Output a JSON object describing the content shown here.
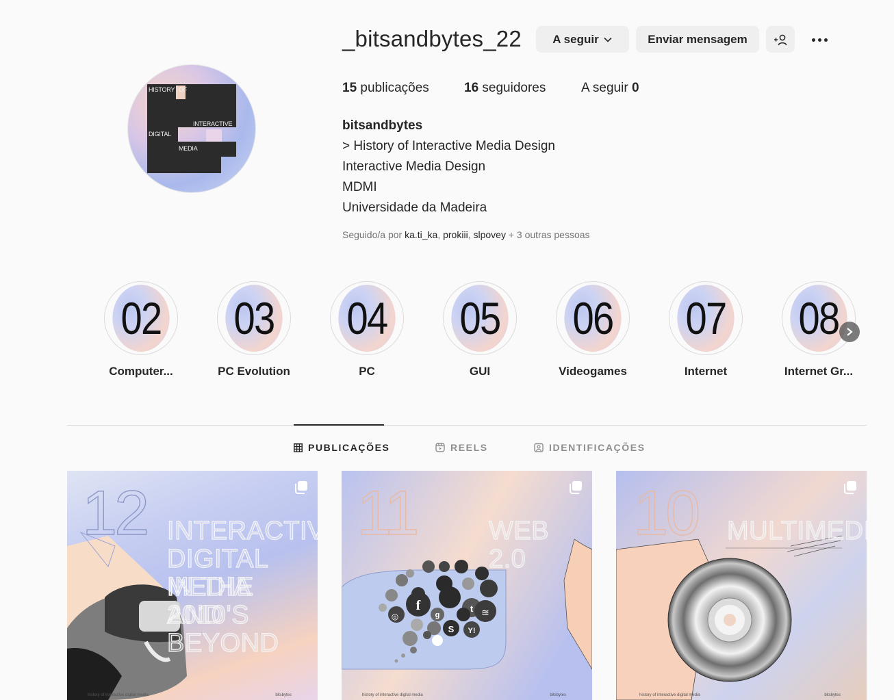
{
  "profile": {
    "username": "_bitsandbytes_22",
    "follow_button": "A seguir",
    "message_button": "Enviar mensagem",
    "stats": {
      "posts_count": "15",
      "posts_label": "publicações",
      "followers_count": "16",
      "followers_label": "seguidores",
      "following_label": "A seguir",
      "following_count": "0"
    },
    "bio": {
      "name": "bitsandbytes",
      "lines": [
        "> History of Interactive Media Design",
        "Interactive Media Design",
        "MDMI",
        "Universidade da Madeira"
      ]
    },
    "followed_by": {
      "prefix": "Seguido/a por",
      "users": [
        "ka.ti_ka",
        "prokiii",
        "slpovey"
      ],
      "suffix": "+ 3 outras pessoas"
    },
    "avatar_words": [
      "HISTORY",
      "OF",
      "INTERACTIVE",
      "DIGITAL",
      "MEDIA"
    ]
  },
  "highlights": [
    {
      "number": "02",
      "label": "Computer..."
    },
    {
      "number": "03",
      "label": "PC Evolution"
    },
    {
      "number": "04",
      "label": "PC"
    },
    {
      "number": "05",
      "label": "GUI"
    },
    {
      "number": "06",
      "label": "Videogames"
    },
    {
      "number": "07",
      "label": "Internet"
    },
    {
      "number": "08",
      "label": "Internet Gr..."
    }
  ],
  "tabs": [
    {
      "label": "PUBLICAÇÕES",
      "icon": "grid-icon",
      "active": true
    },
    {
      "label": "REELS",
      "icon": "reels-icon",
      "active": false
    },
    {
      "label": "IDENTIFICAÇÕES",
      "icon": "tagged-icon",
      "active": false
    }
  ],
  "posts": [
    {
      "number": "12",
      "title_lines": [
        "INTERACTIVE",
        "DIGITAL MEDIA",
        "IN THE 2010'S",
        "AND BEYOND"
      ],
      "footer_left": "history of interactive digital media",
      "footer_right": "bitsbytes"
    },
    {
      "number": "11",
      "title_lines": [
        "WEB 2.0"
      ],
      "footer_left": "history of interactive digital media",
      "footer_right": "bitsbytes"
    },
    {
      "number": "10",
      "title_lines": [
        "MULTIMEDIA"
      ],
      "footer_left": "history of interactive digital media",
      "footer_right": "bitsbytes"
    }
  ],
  "colors": {
    "text": "#262626",
    "muted": "#737373",
    "button_bg": "#efefef",
    "page_bg": "#fafafa"
  }
}
